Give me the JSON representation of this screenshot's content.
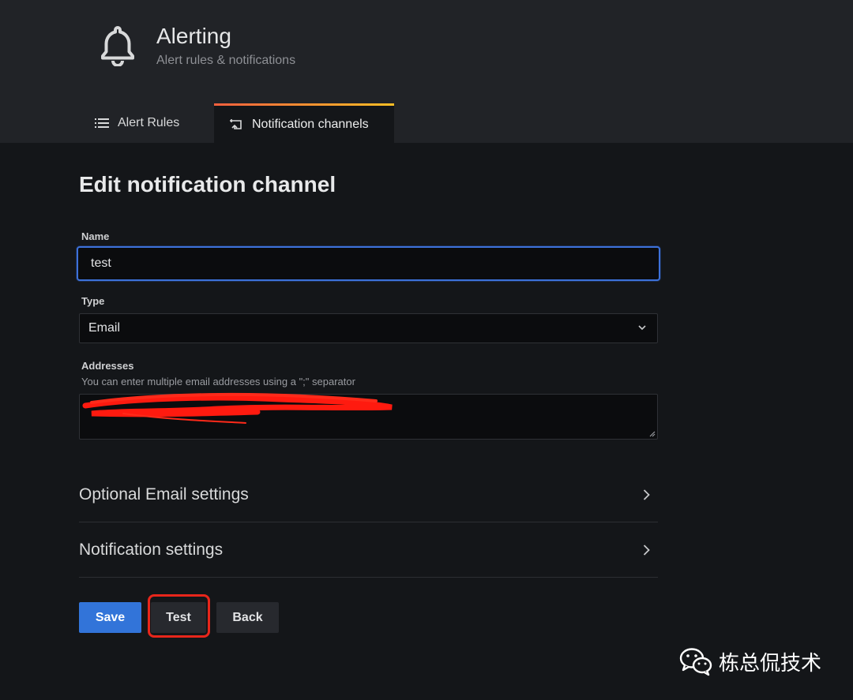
{
  "header": {
    "title": "Alerting",
    "subtitle": "Alert rules & notifications",
    "icon": "bell-icon"
  },
  "tabs": [
    {
      "label": "Alert Rules",
      "icon": "list-icon",
      "active": false
    },
    {
      "label": "Notification channels",
      "icon": "notification-channel-icon",
      "active": true
    }
  ],
  "page": {
    "title": "Edit notification channel"
  },
  "form": {
    "name_label": "Name",
    "name_value": "test",
    "type_label": "Type",
    "type_value": "Email",
    "addresses_label": "Addresses",
    "addresses_description": "You can enter multiple email addresses using a \";\" separator"
  },
  "sections": [
    {
      "label": "Optional Email settings"
    },
    {
      "label": "Notification settings"
    }
  ],
  "buttons": {
    "save": "Save",
    "test": "Test",
    "back": "Back"
  },
  "watermark": {
    "text": "栋总侃技术",
    "icon": "wechat-icon"
  },
  "colors": {
    "primary": "#3274d9",
    "focus": "#3d71d9",
    "highlight": "#e8261b",
    "tab_accent_start": "#f55f3e",
    "tab_accent_end": "#ffbf25"
  }
}
